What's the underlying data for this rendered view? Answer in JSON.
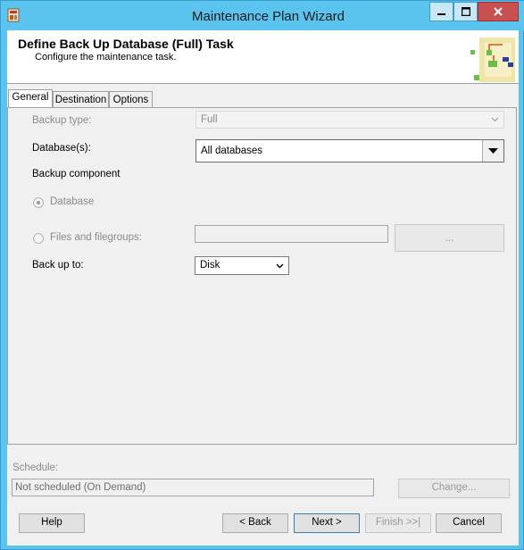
{
  "window": {
    "title": "Maintenance Plan Wizard",
    "controls": {
      "minimize": "minimize-icon",
      "maximize": "maximize-icon",
      "close": "close-icon"
    }
  },
  "header": {
    "title": "Define Back Up Database (Full) Task",
    "subtitle": "Configure the maintenance task."
  },
  "tabs": [
    {
      "label": "General",
      "active": true
    },
    {
      "label": "Destination",
      "active": false
    },
    {
      "label": "Options",
      "active": false
    }
  ],
  "general": {
    "backup_type_label": "Backup type:",
    "backup_type_value": "Full",
    "databases_label": "Database(s):",
    "databases_value": "All databases",
    "backup_component_label": "Backup component",
    "radio_database": "Database",
    "radio_files": "Files and filegroups:",
    "files_value": "",
    "browse_label": "...",
    "backup_to_label": "Back up to:",
    "backup_to_value": "Disk"
  },
  "schedule": {
    "label": "Schedule:",
    "value": "Not scheduled (On Demand)",
    "change_label": "Change..."
  },
  "footer": {
    "help": "Help",
    "back": "< Back",
    "next": "Next >",
    "finish": "Finish >>|",
    "cancel": "Cancel"
  },
  "colors": {
    "titlebar": "#5bc4ee",
    "close_button": "#c75050",
    "client_bg": "#f0f0f0",
    "disabled_text": "#8a8a8a"
  }
}
